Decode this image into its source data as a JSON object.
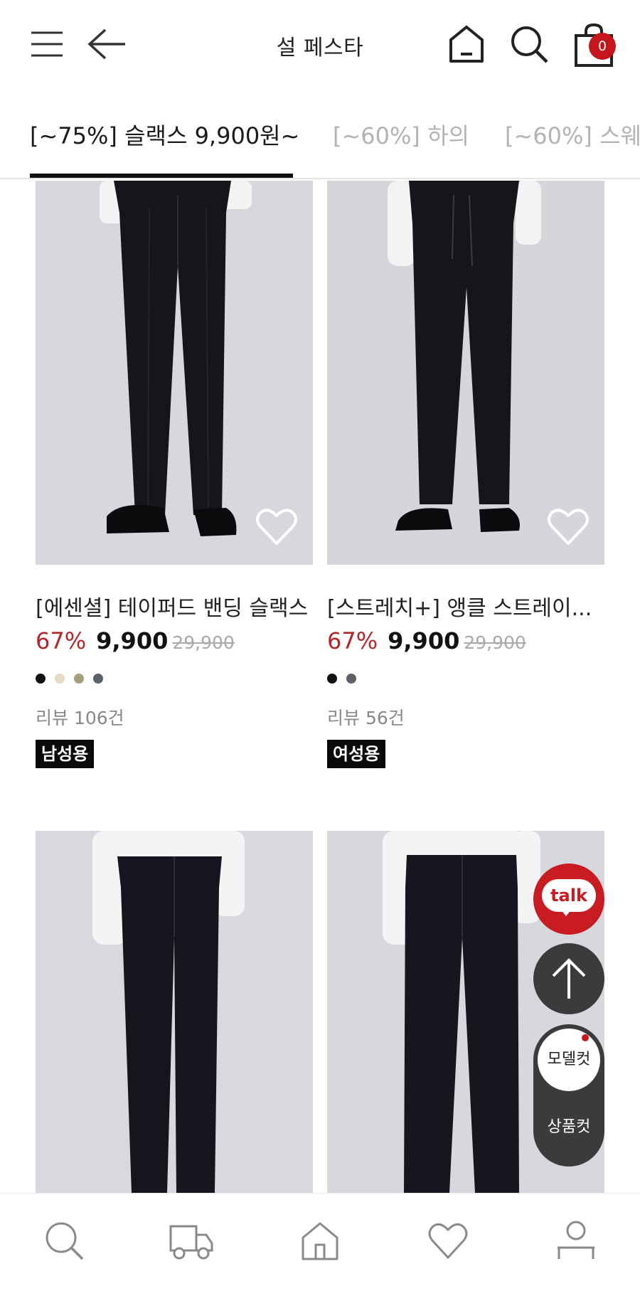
{
  "header": {
    "title": "설 페스타",
    "cart_count": "0"
  },
  "tabs": [
    {
      "label": "[~75%] 슬랙스 9,900원~",
      "active": true
    },
    {
      "label": "[~60%] 하의",
      "active": false
    },
    {
      "label": "[~60%] 스웨...",
      "active": false
    }
  ],
  "products": [
    {
      "name": "[에센셜] 테이퍼드 밴딩 슬랙스",
      "discount": "67%",
      "price": "9,900",
      "original_price": "29,900",
      "swatches": [
        "#111111",
        "#e6dcc3",
        "#a79e7c",
        "#5d6066"
      ],
      "review": "리뷰 106건",
      "tag": "남성용"
    },
    {
      "name": "[스트레치+] 앵클 스트레이...",
      "discount": "67%",
      "price": "9,900",
      "original_price": "29,900",
      "swatches": [
        "#111111",
        "#5d6066"
      ],
      "review": "리뷰 56건",
      "tag": "여성용"
    }
  ],
  "floating": {
    "talk_label": "talk",
    "model_cut_label": "모델컷",
    "product_cut_label": "상품컷"
  },
  "colors": {
    "accent_red": "#c4161c",
    "discount_red": "#b5262b"
  },
  "bottom_nav": [
    "search-icon",
    "delivery-truck-icon",
    "home-icon",
    "heart-icon",
    "user-icon"
  ]
}
